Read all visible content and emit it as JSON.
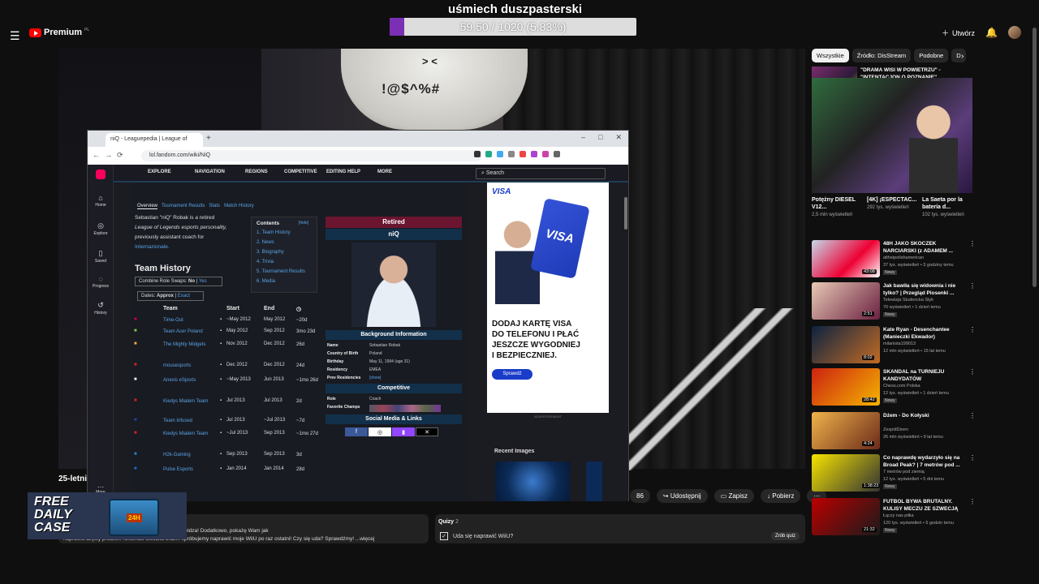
{
  "stream": {
    "title": "uśmiech duszpasterski",
    "progress_text": "59.50 / 1020 (5.83%)",
    "progress_fraction": 0.0583
  },
  "youtube": {
    "logo_text": "Premium",
    "logo_sup": "PL",
    "create_label": "Utwórz",
    "video_title_partial": "25-letni",
    "actions": [
      "86",
      "Udostępnij",
      "Zapisz",
      "Pobierz"
    ],
    "description_line1": "ą Nintendo Gameboy Advance, którego kupiłem od widza! Dodatkowo, pokażę Wam jak",
    "description_line2": "naprawić częsty problem Nintendo Switcha oraz... spróbujemy naprawić moje WiiU po raz ostatni! Czy się uda? Sprawdźmy!   ...więcej",
    "quiz_title": "Quizy",
    "quiz_count": "2",
    "quiz_question": "Uda się naprawić WiiU?",
    "quiz_button": "Zrób quiz",
    "case_text": [
      "FREE",
      "DAILY",
      "CASE"
    ],
    "case_badge": "24H",
    "more_label": "More"
  },
  "video": {
    "cap_text": "!@$^%#",
    "cap_face": "> <"
  },
  "browser": {
    "tab_title": "niQ - Leaguepedia | League of",
    "url": "lol.fandom.com/wiki/NiQ"
  },
  "wiki": {
    "side_items": [
      "Home",
      "Explore",
      "Saved",
      "Progress",
      "History"
    ],
    "nav": [
      "EXPLORE",
      "NAVIGATION",
      "REGIONS",
      "COMPETITIVE",
      "EDITING HELP",
      "MORE"
    ],
    "search": "Search",
    "page_tabs": [
      "Overview",
      "Tournament Results",
      "Stats",
      "Match History"
    ],
    "intro": [
      "Sebastian \"niQ\" Robak is a retired",
      "League of Legends esports personality,",
      "previously assistant coach for",
      "Internazionale."
    ],
    "team_history_heading": "Team History",
    "combine_label": "Combine Role Swaps:",
    "combine_no": "No",
    "combine_yes": "Yes",
    "dates_label": "Dates:",
    "dates_approx": "Approx",
    "dates_exact": "Exact",
    "toc_title": "Contents",
    "toc_hide": "[hide]",
    "toc": [
      "1. Team History",
      "2. News",
      "3. Biography",
      "4. Trivia",
      "5. Tournament Results",
      "6. Media"
    ],
    "table_headers": [
      "Team",
      "Start",
      "End"
    ],
    "table_rows": [
      {
        "team": "Time-Out",
        "start": "~May 2012",
        "end": "May 2012",
        "dur": "~20d"
      },
      {
        "team": "Team Acer Poland",
        "start": "May 2012",
        "end": "Sep 2012",
        "dur": "3mo 23d"
      },
      {
        "team": "The Mighty Midgets",
        "start": "Nov 2012",
        "end": "Dec 2012",
        "dur": "26d"
      },
      {
        "team": "mousesports",
        "start": "Dec 2012",
        "end": "Dec 2012",
        "dur": "24d"
      },
      {
        "team": "Anexis eSports",
        "start": "~May 2013",
        "end": "Jun 2013",
        "dur": "~1mo 26d"
      },
      {
        "team": "Kiedys Mialem Team",
        "start": "Jul 2013",
        "end": "Jul 2013",
        "dur": "2d"
      },
      {
        "team": "Team Infused",
        "start": "Jul 2013",
        "end": "~Jul 2013",
        "dur": "~7d"
      },
      {
        "team": "Kiedys Mialem Team",
        "start": "~Jul 2013",
        "end": "Sep 2013",
        "dur": "~1mo 27d"
      },
      {
        "team": "H2k-Gaming",
        "start": "Sep 2013",
        "end": "Sep 2013",
        "dur": "3d"
      },
      {
        "team": "Pulse Esports",
        "start": "Jan 2014",
        "end": "Jan 2014",
        "dur": "28d"
      }
    ],
    "infobox": {
      "status": "Retired",
      "name": "niQ",
      "background_heading": "Background Information",
      "rows": [
        {
          "k": "Name",
          "v": "Sebastian Robak"
        },
        {
          "k": "Country of Birth",
          "v": "Poland"
        },
        {
          "k": "Birthday",
          "v": "May 11, 1994 (age 31)"
        },
        {
          "k": "Residency",
          "v": "EMEA"
        },
        {
          "k": "Prev Residencies",
          "v": "[show]"
        }
      ],
      "competitive_heading": "Competitive",
      "role_label": "Role",
      "role_value": "Coach",
      "champs_label": "Favorite Champs",
      "social_heading": "Social Media & Links"
    },
    "ad": {
      "brand": "VISA",
      "headline": [
        "DODAJ KARTĘ VISA",
        "DO TELEFONU I PŁAĆ",
        "JESZCZE WYGODNIEJ",
        "I BEZPIECZNIEJ."
      ],
      "button": "Sprawdź",
      "label": "ADVERTISEMENT"
    },
    "recent_images": "Recent Images"
  },
  "sidebar": {
    "chips": [
      "Wszystkie",
      "Źródło: DisStream",
      "Podobne",
      "D"
    ],
    "first_title": "\"DRAMA WISI W POWIETRZU\" - \"INTENTACJON O POZNANIE\"",
    "shorts": [
      {
        "title": "Potężny DIESEL V12...",
        "views": "2,5 mln wyświetleń"
      },
      {
        "title": "[4K] ¡ESPECTAC...",
        "views": "292 tys. wyświetleń"
      },
      {
        "title": "La Saeta por la batería d...",
        "views": "102 tys. wyświetleń"
      }
    ],
    "recs": [
      {
        "title": "48H JAKO SKOCZEK NARCIARSKI (z ADAMEM ...",
        "channel": "altheipolishamerican",
        "views": "37 tys. wyświetleń • 3 godziny temu",
        "badge": "Nowy",
        "duration": "43:08"
      },
      {
        "title": "Jak bawiła się widownia i nie tylko? | Przegląd Piosenki ...",
        "channel": "Telewizja Studencka Styk",
        "views": "70 wyświetleń • 1 dzień temu",
        "badge": "Nowy",
        "duration": "2:51"
      },
      {
        "title": "Kate Ryan - Desenchantee (Manieczki Ekwador)",
        "channel": "milanista199013",
        "views": "12 mln wyświetleń • 15 lat temu",
        "badge": "",
        "duration": "8:02"
      },
      {
        "title": "SKANDAL na TURNIEJU KANDYDATÓW",
        "channel": "Chess.com Polska",
        "views": "12 tys. wyświetleń • 1 dzień temu",
        "badge": "Nowy",
        "duration": "28:42"
      },
      {
        "title": "Dżem - Do Kołyski",
        "channel": "ZespółDżem",
        "views": "26 mln wyświetleń • 9 lat temu",
        "badge": "",
        "duration": "4:24"
      },
      {
        "title": "Co naprawdę wydarzyło się na Broad Peak? | 7 metrów pod ...",
        "channel": "7 metrów pod ziemią",
        "views": "12 tys. wyświetleń • 5 dni temu",
        "badge": "Nowy",
        "duration": "1:38:23"
      },
      {
        "title": "FUTBOL BYWA BRUTALNY. KULISY MECZU ZE SZWECJĄ ...",
        "channel": "Łączy nas piłka",
        "views": "120 tys. wyświetleń • 5 godzin temu",
        "badge": "Nowy",
        "duration": "21:32"
      }
    ]
  },
  "colors": {
    "progress_fill": "#7b2fb5",
    "yt_red": "#ff0000",
    "wiki_header": "#12304a",
    "retired_bar": "#6b1530",
    "visa_blue": "#1a3cc8"
  }
}
